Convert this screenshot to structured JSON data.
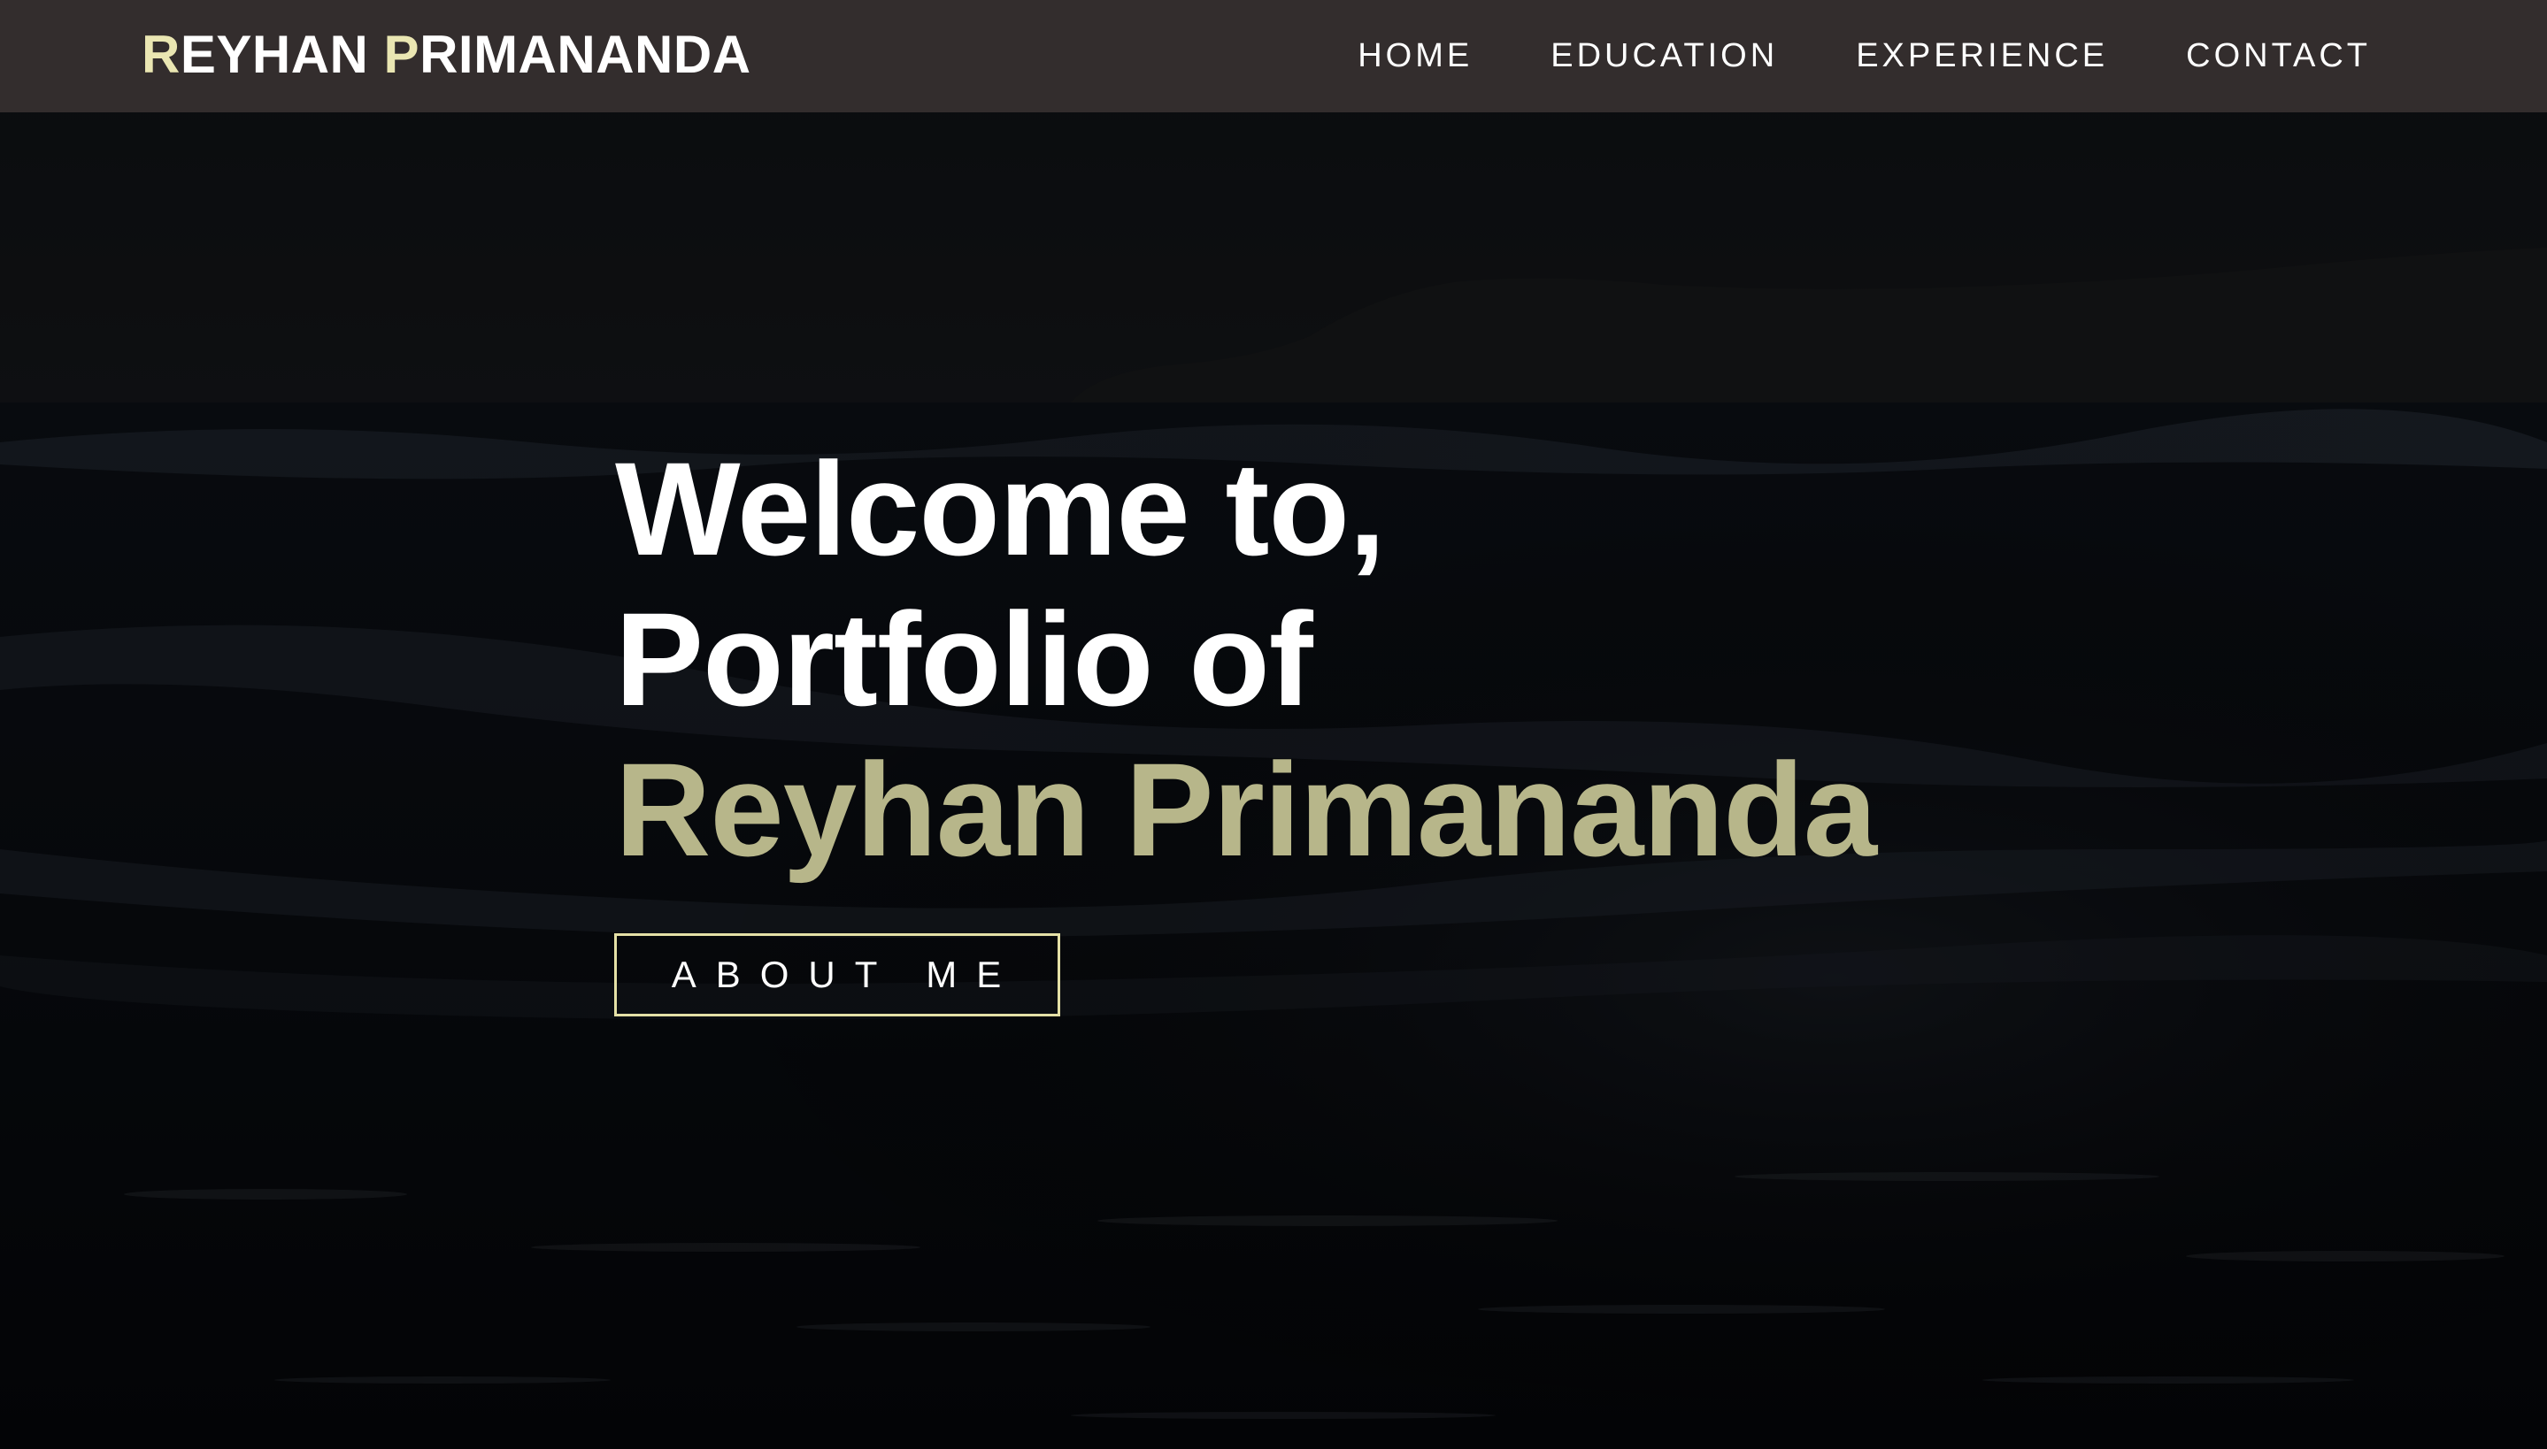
{
  "navbar": {
    "brand": {
      "first_initial": "R",
      "first_rest": "EYHAN ",
      "last_initial": "P",
      "last_rest": "RIMANANDA"
    },
    "links": [
      {
        "label": "HOME"
      },
      {
        "label": "EDUCATION"
      },
      {
        "label": "EXPERIENCE"
      },
      {
        "label": "CONTACT"
      }
    ]
  },
  "hero": {
    "line1": "Welcome to,",
    "line2": "Portfolio of",
    "line3": "Reyhan Primananda",
    "button_label": "ABOUT ME",
    "background_icon": "ocean-beach-night-photo"
  },
  "colors": {
    "navbar_bg": "#332d2d",
    "brand_accent": "#eae6b2",
    "headline_accent": "#b7b68a",
    "button_border": "#e4e0a6",
    "page_bg": "#07080b"
  }
}
